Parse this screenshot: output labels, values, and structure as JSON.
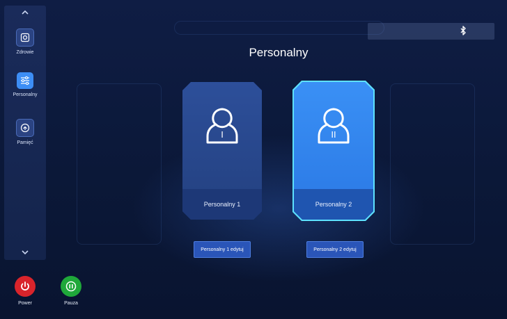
{
  "sidebar": {
    "items": [
      {
        "label": "Zdrowie",
        "icon": "health-icon",
        "active": false
      },
      {
        "label": "Personalny",
        "icon": "sliders-icon",
        "active": true
      },
      {
        "label": "Pamięć",
        "icon": "memory-icon",
        "active": false
      }
    ]
  },
  "main": {
    "title": "Personalny",
    "cards": [
      {
        "label": "Personalny 1",
        "roman": "I",
        "selected": false
      },
      {
        "label": "Personalny 2",
        "roman": "II",
        "selected": true
      }
    ],
    "edit_buttons": [
      {
        "label": "Personalny 1 edytuj"
      },
      {
        "label": "Personalny 2 edytuj"
      }
    ]
  },
  "status_bar": {
    "icon": "bluetooth-icon"
  },
  "controls": {
    "power_label": "Power",
    "pause_label": "Pauza"
  },
  "colors": {
    "accent": "#3d8ef5",
    "selected_border": "#5ee2ff",
    "power": "#d9242b",
    "pause": "#1fa83a"
  }
}
